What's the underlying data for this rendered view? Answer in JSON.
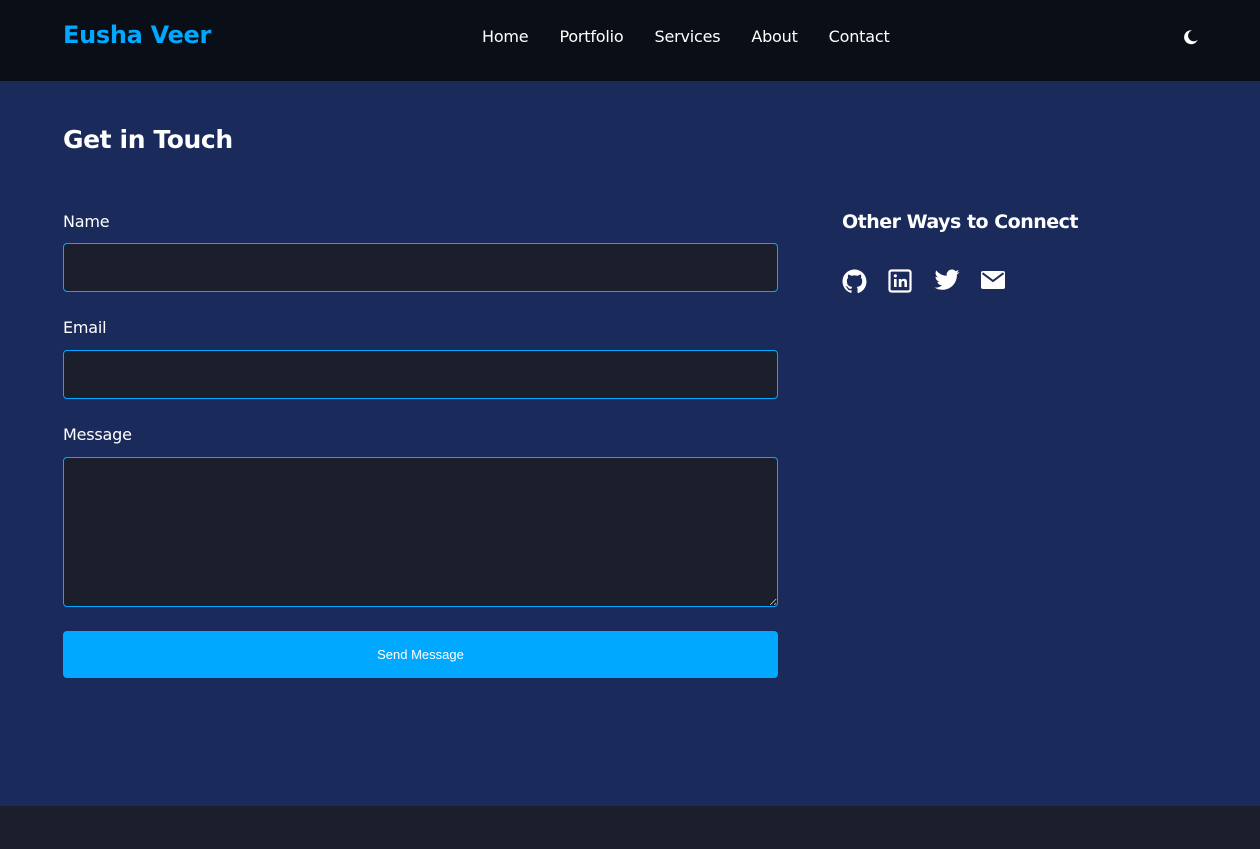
{
  "brand": {
    "name": "Eusha Veer"
  },
  "nav": {
    "items": [
      {
        "label": "Home"
      },
      {
        "label": "Portfolio"
      },
      {
        "label": "Services"
      },
      {
        "label": "About"
      },
      {
        "label": "Contact"
      }
    ],
    "theme_toggle_icon": "moon-icon"
  },
  "contact": {
    "title": "Get in Touch",
    "form": {
      "name_label": "Name",
      "name_value": "",
      "email_label": "Email",
      "email_value": "",
      "message_label": "Message",
      "message_value": "",
      "submit_label": "Send Message"
    },
    "other": {
      "title": "Other Ways to Connect",
      "links": [
        {
          "icon": "github-icon"
        },
        {
          "icon": "linkedin-icon"
        },
        {
          "icon": "twitter-icon"
        },
        {
          "icon": "envelope-icon"
        }
      ]
    }
  },
  "colors": {
    "accent": "#00a8ff",
    "navbar_bg": "#0a0e17",
    "section_bg": "#1a2a5a",
    "input_bg": "#1b1e2b",
    "footer_bg": "#1b1e2b",
    "text": "#ffffff"
  }
}
